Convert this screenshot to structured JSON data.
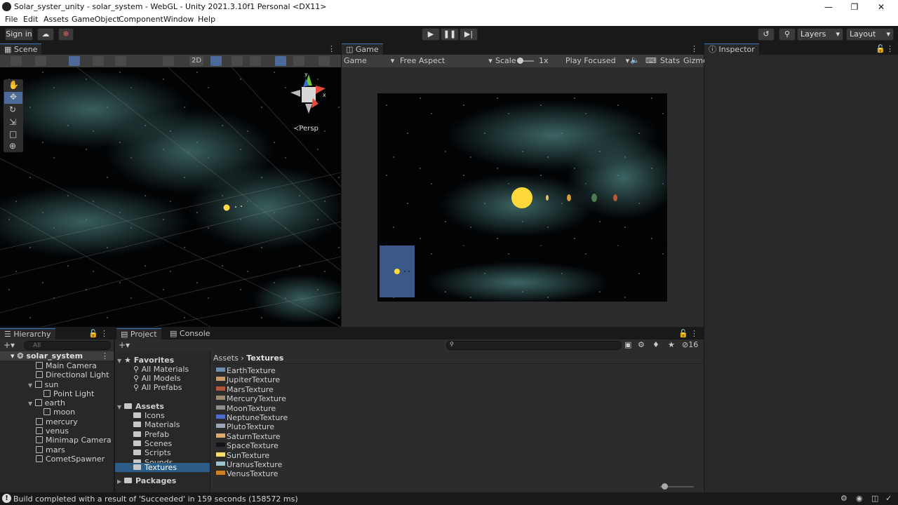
{
  "window": {
    "title": "Solar_syster_unity - solar_system - WebGL - Unity 2021.3.10f1 Personal <DX11>"
  },
  "menu": [
    "File",
    "Edit",
    "Assets",
    "GameObject",
    "Component",
    "Window",
    "Help"
  ],
  "toolbar": {
    "sign_in": "Sign in",
    "layers": "Layers",
    "layout": "Layout"
  },
  "scene": {
    "tab": "Scene",
    "btn_2d": "2D",
    "persp": "Persp",
    "axis_x": "x",
    "axis_y": "y"
  },
  "game": {
    "tab": "Game",
    "display": "Game",
    "aspect": "Free Aspect",
    "scale_label": "Scale",
    "scale_value": "1x",
    "play_mode": "Play Focused",
    "stats": "Stats",
    "gizmos": "Gizmo"
  },
  "inspector": {
    "tab": "Inspector"
  },
  "hierarchy": {
    "tab": "Hierarchy",
    "search_placeholder": "All",
    "scene_name": "solar_system",
    "items": [
      "Main Camera",
      "Directional Light",
      "sun",
      "Point Light",
      "earth",
      "moon",
      "mercury",
      "venus",
      "Minimap Camera",
      "mars",
      "CometSpawner"
    ]
  },
  "project": {
    "tab": "Project",
    "console_tab": "Console",
    "favorites": "Favorites",
    "favorite_items": [
      "All Materials",
      "All Models",
      "All Prefabs"
    ],
    "assets": "Assets",
    "asset_folders": [
      "Icons",
      "Materials",
      "Prefab",
      "Scenes",
      "Scripts",
      "Sounds",
      "Textures"
    ],
    "packages": "Packages",
    "breadcrumb_root": "Assets",
    "breadcrumb_current": "Textures",
    "hidden_count": "16",
    "files": [
      {
        "name": "EarthTexture",
        "color": "#6f8fb0"
      },
      {
        "name": "JupiterTexture",
        "color": "#c99a6a"
      },
      {
        "name": "MarsTexture",
        "color": "#b5553a"
      },
      {
        "name": "MercuryTexture",
        "color": "#a08a70"
      },
      {
        "name": "MoonTexture",
        "color": "#8d8d8d"
      },
      {
        "name": "NeptuneTexture",
        "color": "#4a6ed0"
      },
      {
        "name": "PlutoTexture",
        "color": "#9aa5b5"
      },
      {
        "name": "SaturnTexture",
        "color": "#d9aa74"
      },
      {
        "name": "SpaceTexture",
        "color": "#111418"
      },
      {
        "name": "SunTexture",
        "color": "#f7e070"
      },
      {
        "name": "UranusTexture",
        "color": "#9ec3cf"
      },
      {
        "name": "VenusTexture",
        "color": "#d0801f"
      }
    ]
  },
  "status": {
    "message": "Build completed with a result of 'Succeeded' in 159 seconds (158572 ms)"
  }
}
